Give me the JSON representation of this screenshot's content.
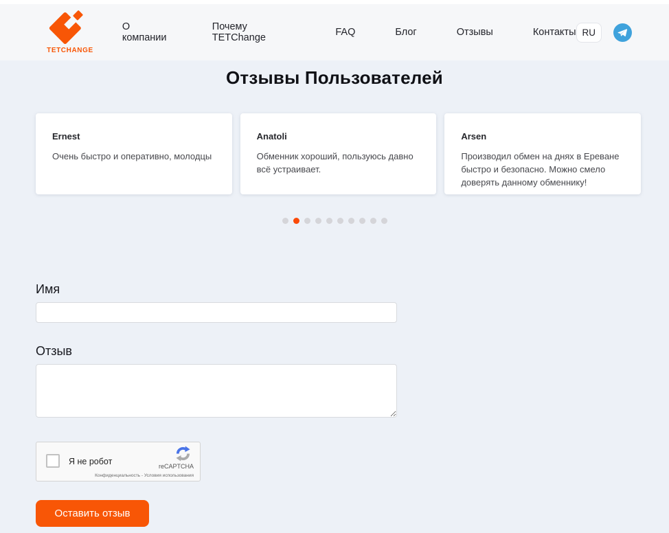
{
  "header": {
    "logo_text": "TETCHANGE",
    "nav_items": [
      "О компании",
      "Почему TETChange",
      "FAQ",
      "Блог",
      "Отзывы",
      "Контакты"
    ],
    "language": "RU"
  },
  "icons": {
    "logo": "tetchange-diamond-logo",
    "telegram": "telegram-paper-plane",
    "recaptcha": "recaptcha-circular-arrow"
  },
  "reviews": {
    "section_title": "Отзывы Пользователей",
    "cards": [
      {
        "name": "Ernest",
        "text": "Очень быстро и оперативно, молодцы"
      },
      {
        "name": "Anatoli",
        "text": "Обменник хороший, пользуюсь давно всё устраивает."
      },
      {
        "name": "Arsen",
        "text": "Производил обмен на днях в Ереване быстро и безопасно. Можно смело доверять данному обменнику!"
      }
    ],
    "pagination": {
      "total_dots": 10,
      "active_index": 1
    }
  },
  "form": {
    "name_label": "Имя",
    "name_value": "",
    "review_label": "Отзыв",
    "review_value": "",
    "submit_label": "Оставить отзыв"
  },
  "captcha": {
    "checkbox_label": "Я не робот",
    "brand": "reCAPTCHA",
    "terms": "Конфиденциальность - Условия использования"
  },
  "colors": {
    "brand_orange": "#f85606",
    "active_dot": "#fb4a08",
    "telegram_blue": "#3fa2dc",
    "header_bg": "#f6f7f9",
    "page_bg": "#edf1f7"
  }
}
